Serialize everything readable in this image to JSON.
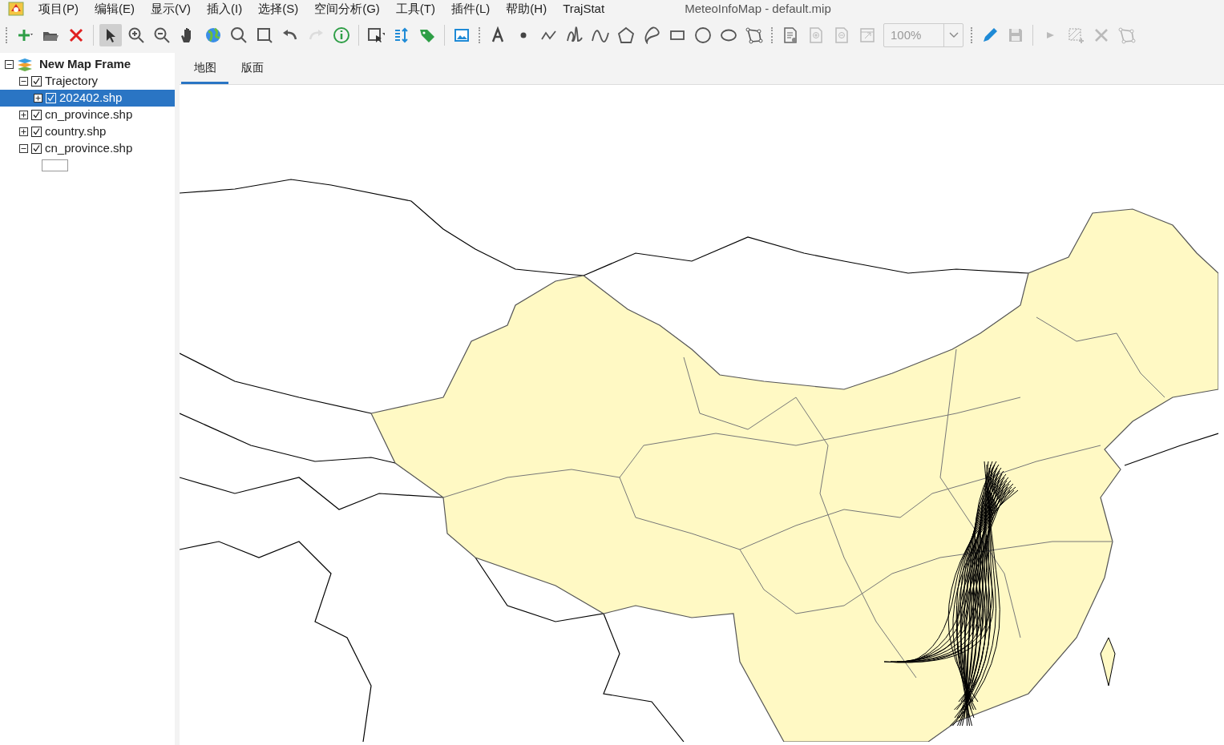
{
  "window": {
    "title": "MeteoInfoMap - default.mip"
  },
  "menu": [
    "项目(P)",
    "编辑(E)",
    "显示(V)",
    "插入(I)",
    "选择(S)",
    "空间分析(G)",
    "工具(T)",
    "插件(L)",
    "帮助(H)",
    "TrajStat"
  ],
  "toolbar": [
    {
      "kind": "grip"
    },
    {
      "kind": "add",
      "disabled": false,
      "selected": false
    },
    {
      "kind": "open",
      "disabled": false,
      "selected": false
    },
    {
      "kind": "remove",
      "disabled": false,
      "selected": false
    },
    {
      "kind": "separator"
    },
    {
      "kind": "select",
      "disabled": false,
      "selected": true
    },
    {
      "kind": "zoom-in",
      "disabled": false,
      "selected": false
    },
    {
      "kind": "zoom-out",
      "disabled": false,
      "selected": false
    },
    {
      "kind": "pan",
      "disabled": false,
      "selected": false
    },
    {
      "kind": "globe",
      "disabled": false,
      "selected": false
    },
    {
      "kind": "magnifier",
      "disabled": false,
      "selected": false
    },
    {
      "kind": "zoom-rect",
      "disabled": false,
      "selected": false
    },
    {
      "kind": "undo",
      "disabled": false,
      "selected": false
    },
    {
      "kind": "redo",
      "disabled": true,
      "selected": false
    },
    {
      "kind": "info",
      "disabled": false,
      "selected": false
    },
    {
      "kind": "separator"
    },
    {
      "kind": "select-box",
      "disabled": false,
      "selected": false
    },
    {
      "kind": "measure",
      "disabled": false,
      "selected": false
    },
    {
      "kind": "label",
      "disabled": false,
      "selected": false
    },
    {
      "kind": "separator"
    },
    {
      "kind": "image",
      "disabled": false,
      "selected": false
    },
    {
      "kind": "grip"
    },
    {
      "kind": "text",
      "disabled": false,
      "selected": false
    },
    {
      "kind": "point",
      "disabled": false,
      "selected": false
    },
    {
      "kind": "polyline",
      "disabled": false,
      "selected": false
    },
    {
      "kind": "freehand",
      "disabled": false,
      "selected": false
    },
    {
      "kind": "curve",
      "disabled": false,
      "selected": false
    },
    {
      "kind": "polygon",
      "disabled": false,
      "selected": false
    },
    {
      "kind": "blob",
      "disabled": false,
      "selected": false
    },
    {
      "kind": "rectangle",
      "disabled": false,
      "selected": false
    },
    {
      "kind": "circle",
      "disabled": false,
      "selected": false
    },
    {
      "kind": "ellipse",
      "disabled": false,
      "selected": false
    },
    {
      "kind": "vertices",
      "disabled": false,
      "selected": false
    },
    {
      "kind": "grip"
    },
    {
      "kind": "page-setup",
      "disabled": false,
      "selected": false
    },
    {
      "kind": "page-zoom-in",
      "disabled": true,
      "selected": false
    },
    {
      "kind": "page-zoom-out",
      "disabled": true,
      "selected": false
    },
    {
      "kind": "page-fit",
      "disabled": true,
      "selected": false
    },
    {
      "kind": "zoom-field",
      "value": "100%"
    },
    {
      "kind": "grip"
    },
    {
      "kind": "pen",
      "disabled": false,
      "selected": false
    },
    {
      "kind": "save",
      "disabled": true,
      "selected": false
    },
    {
      "kind": "separator"
    },
    {
      "kind": "play",
      "disabled": true,
      "selected": false
    },
    {
      "kind": "add-feature",
      "disabled": true,
      "selected": false
    },
    {
      "kind": "delete",
      "disabled": true,
      "selected": false
    },
    {
      "kind": "vertices",
      "disabled": true,
      "selected": false
    }
  ],
  "layers": [
    {
      "label": "New Map Frame",
      "kind": "frame",
      "expanded": true,
      "selected": false,
      "children": [
        {
          "label": "Trajectory",
          "expanded": true,
          "checked": true,
          "selected": false,
          "children": [
            {
              "label": "202402.shp",
              "expanded": false,
              "checked": true,
              "selected": true
            }
          ]
        },
        {
          "label": "cn_province.shp",
          "expanded": false,
          "checked": true,
          "selected": false
        },
        {
          "label": "country.shp",
          "expanded": false,
          "checked": true,
          "selected": false
        },
        {
          "label": "cn_province.shp",
          "expanded": true,
          "checked": true,
          "selected": false,
          "children": [
            {
              "kind": "swatch"
            }
          ]
        }
      ]
    }
  ],
  "tabs": [
    {
      "label": "地图",
      "selected": true
    },
    {
      "label": "版面",
      "selected": false
    }
  ]
}
